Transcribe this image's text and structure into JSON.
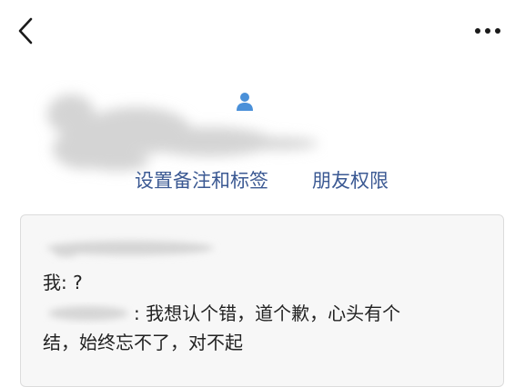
{
  "links": {
    "remark_tags": "设置备注和标签",
    "permissions": "朋友权限"
  },
  "card": {
    "my_line": "我: ?",
    "reply_text": ": 我想认个错，道个歉，心头有个",
    "reply_text_cont": "结，始终忘不了，对不起"
  },
  "colors": {
    "link": "#3b5993",
    "contact_icon": "#4a90d9",
    "card_bg": "#f7f7f7"
  },
  "icons": {
    "back": "chevron-left-icon",
    "more": "more-dots-icon",
    "contact": "person-icon"
  }
}
